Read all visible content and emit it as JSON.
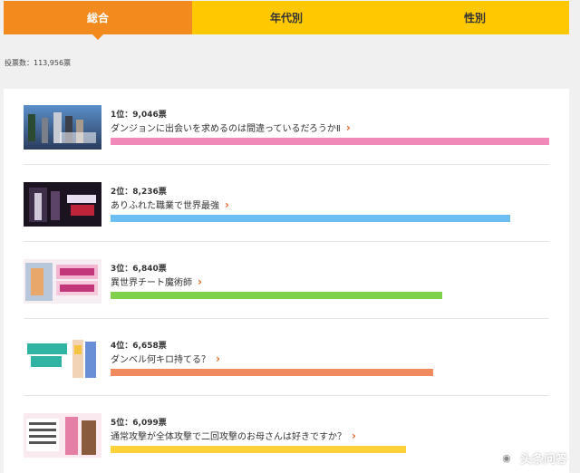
{
  "tabs": [
    {
      "label": "総合",
      "active": true
    },
    {
      "label": "年代別",
      "active": false
    },
    {
      "label": "性別",
      "active": false
    }
  ],
  "vote_total": "投票数：113,956票",
  "items": [
    {
      "rank_text": "1位：9,046票",
      "title": "ダンジョンに出会いを求めるのは間違っているだろうかⅡ",
      "votes": 9046,
      "bar_color": "#f088b8",
      "thumb": "dungeon-anime-thumbnail"
    },
    {
      "rank_text": "2位：8,236票",
      "title": "ありふれた職業で世界最強",
      "votes": 8236,
      "bar_color": "#6cbdf0",
      "thumb": "arifureta-anime-thumbnail"
    },
    {
      "rank_text": "3位：6,840票",
      "title": "異世界チート魔術師",
      "votes": 6840,
      "bar_color": "#7fd04a",
      "thumb": "isekai-cheat-anime-thumbnail"
    },
    {
      "rank_text": "4位：6,658票",
      "title": "ダンベル何キロ持てる？",
      "votes": 6658,
      "bar_color": "#f08a5e",
      "thumb": "dumbbell-anime-thumbnail"
    },
    {
      "rank_text": "5位：6,099票",
      "title": "通常攻撃が全体攻撃で二回攻撃のお母さんは好きですか？",
      "votes": 6099,
      "bar_color": "#ffd23a",
      "thumb": "okaasan-anime-thumbnail"
    }
  ],
  "watermark": "头条问答"
}
